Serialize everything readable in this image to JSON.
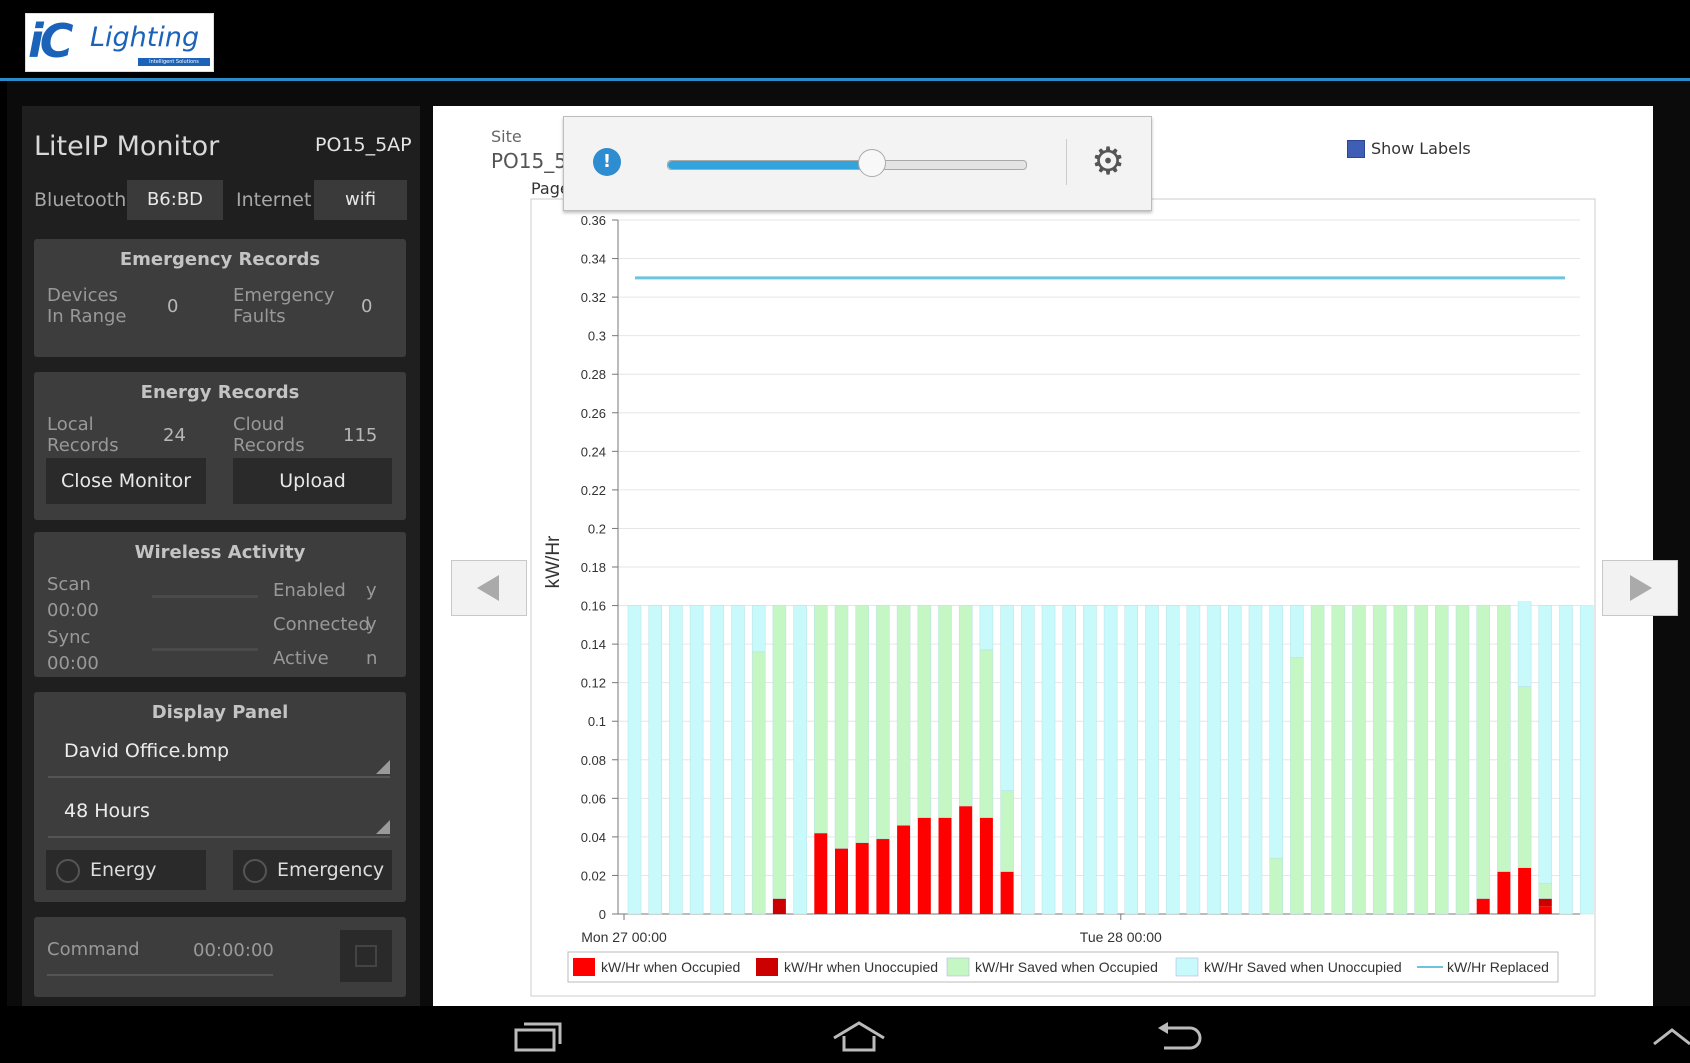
{
  "app": {
    "logo_text": "iC",
    "brand": "Lighting",
    "tagline": "Intelligent Solutions"
  },
  "monitor": {
    "title": "LiteIP Monitor",
    "site_id": "PO15_5AP",
    "bluetooth_label": "Bluetooth",
    "bluetooth_value": "B6:BD",
    "internet_label": "Internet",
    "internet_value": "wifi"
  },
  "emergency_records": {
    "title": "Emergency Records",
    "devices_label_1": "Devices",
    "devices_label_2": "In Range",
    "devices_value": "0",
    "faults_label_1": "Emergency",
    "faults_label_2": "Faults",
    "faults_value": "0"
  },
  "energy_records": {
    "title": "Energy Records",
    "local_label_1": "Local",
    "local_label_2": "Records",
    "local_value": "24",
    "cloud_label_1": "Cloud",
    "cloud_label_2": "Records",
    "cloud_value": "115",
    "close_button": "Close Monitor",
    "upload_button": "Upload"
  },
  "wireless_activity": {
    "title": "Wireless Activity",
    "scan_label": "Scan",
    "scan_time": "00:00",
    "sync_label": "Sync",
    "sync_time": "00:00",
    "enabled_label": "Enabled",
    "enabled_value": "y",
    "connected_label": "Connected",
    "connected_value": "y",
    "active_label": "Active",
    "active_value": "n"
  },
  "display_panel": {
    "title": "Display Panel",
    "image_select": "David Office.bmp",
    "period_select": "48 Hours",
    "energy_radio": "Energy",
    "emergency_radio": "Emergency"
  },
  "command": {
    "label": "Command",
    "time": "00:00:00"
  },
  "chart_header": {
    "site_label": "Site",
    "site_value": "PO15_5",
    "page_label": "Page",
    "show_labels": "Show Labels"
  },
  "slider": {
    "fraction": 0.57,
    "accent": "#33a3dc"
  },
  "chart_data": {
    "type": "bar",
    "ylabel": "kW/Hr",
    "ylim": [
      0,
      0.36
    ],
    "yticks": [
      0,
      0.02,
      0.04,
      0.06,
      0.08,
      0.1,
      0.12,
      0.14,
      0.16,
      0.18,
      0.2,
      0.22,
      0.24,
      0.26,
      0.28,
      0.3,
      0.32,
      0.34,
      0.36
    ],
    "ytick_labels": [
      "0",
      "0.02",
      "0.04",
      "0.06",
      "0.08",
      "0.1",
      "0.12",
      "0.14",
      "0.16",
      "0.18",
      "0.2",
      "0.22",
      "0.24",
      "0.26",
      "0.28",
      "0.3",
      "0.32",
      "0.34",
      "0.36"
    ],
    "xtick_labels": [
      {
        "label": "Mon 27 00:00",
        "index": 0
      },
      {
        "label": "Tue 28 00:00",
        "index": 24
      }
    ],
    "stacked": true,
    "series": [
      {
        "name": "kW/Hr when Occupied",
        "color": "#ff0000",
        "values": [
          0,
          0,
          0,
          0,
          0,
          0,
          0,
          0,
          0,
          0.042,
          0.034,
          0.037,
          0.039,
          0.046,
          0.05,
          0.05,
          0.056,
          0.05,
          0.022,
          0,
          0,
          0,
          0,
          0,
          0,
          0,
          0,
          0,
          0,
          0,
          0,
          0,
          0,
          0,
          0,
          0,
          0,
          0,
          0,
          0,
          0,
          0.008,
          0.022,
          0.024,
          0.004,
          0,
          0
        ]
      },
      {
        "name": "kW/Hr when Unoccupied",
        "color": "#cc0000",
        "values": [
          0,
          0,
          0,
          0,
          0,
          0,
          0,
          0.008,
          0,
          0,
          0,
          0,
          0,
          0,
          0,
          0,
          0,
          0,
          0,
          0,
          0,
          0,
          0,
          0,
          0,
          0,
          0,
          0,
          0,
          0,
          0,
          0,
          0,
          0,
          0,
          0,
          0,
          0,
          0,
          0,
          0,
          0,
          0,
          0,
          0.004,
          0,
          0
        ]
      },
      {
        "name": "kW/Hr Saved when Occupied",
        "color": "#c4f7c4",
        "values": [
          0,
          0,
          0,
          0,
          0,
          0,
          0.136,
          0.152,
          0,
          0.118,
          0.126,
          0.123,
          0.121,
          0.114,
          0.11,
          0.11,
          0.104,
          0.087,
          0.042,
          0,
          0,
          0,
          0,
          0,
          0,
          0,
          0,
          0,
          0,
          0,
          0,
          0.029,
          0.133,
          0.16,
          0.16,
          0.16,
          0.16,
          0.16,
          0.16,
          0.16,
          0.16,
          0.152,
          0.138,
          0.094,
          0.008,
          0,
          0
        ]
      },
      {
        "name": "kW/Hr Saved when Unoccupied",
        "color": "#c8fafc",
        "values": [
          0.16,
          0.16,
          0.16,
          0.16,
          0.16,
          0.16,
          0.024,
          0,
          0.16,
          0,
          0,
          0,
          0,
          0,
          0,
          0,
          0,
          0.023,
          0.096,
          0.16,
          0.16,
          0.16,
          0.16,
          0.16,
          0.16,
          0.16,
          0.16,
          0.16,
          0.16,
          0.16,
          0.16,
          0.131,
          0.027,
          0,
          0,
          0,
          0,
          0,
          0,
          0,
          0,
          0,
          0,
          0.044,
          0.144,
          0.16,
          0.16
        ]
      }
    ],
    "line": {
      "name": "kW/Hr Replaced",
      "color": "#6ec4e0",
      "value": 0.33
    },
    "grid": true,
    "legend_position": "bottom"
  }
}
